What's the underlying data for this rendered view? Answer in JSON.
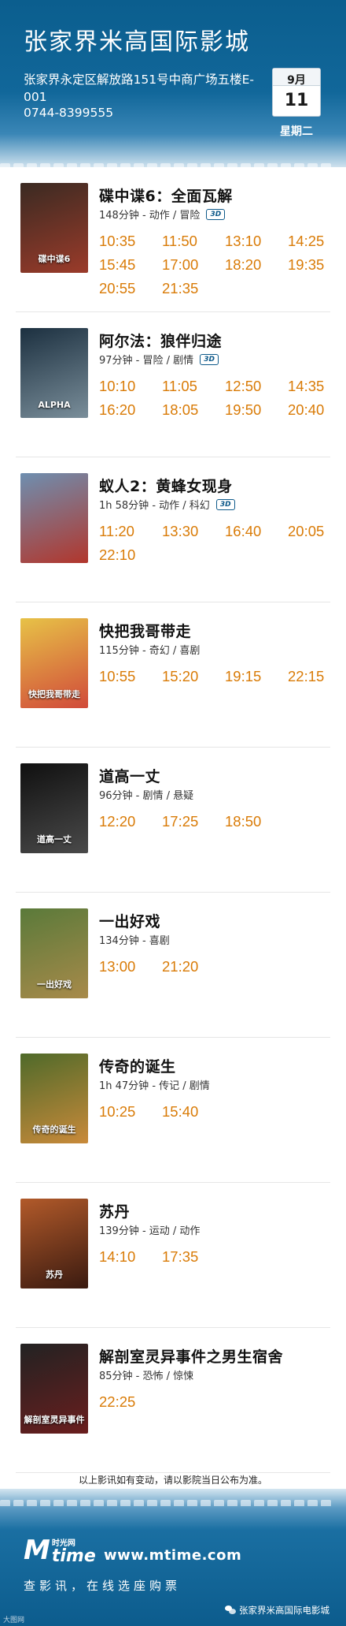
{
  "header": {
    "cinema_name": "张家界米高国际影城",
    "address": "张家界永定区解放路151号中商广场五楼E-001",
    "phone": "0744-8399555",
    "date": {
      "month": "9月",
      "day": "11",
      "weekday": "星期二"
    }
  },
  "badge_label": "3D",
  "movies": [
    {
      "title": "碟中谍6：全面瓦解",
      "meta": "148分钟 - 动作 / 冒险",
      "is_3d": true,
      "times": [
        "10:35",
        "11:50",
        "13:10",
        "14:25",
        "15:45",
        "17:00",
        "18:20",
        "19:35",
        "20:55",
        "21:35"
      ],
      "poster_colors": [
        "#3a2a22",
        "#9b3b2a"
      ],
      "poster_text": "碟中谍6"
    },
    {
      "title": "阿尔法：狼伴归途",
      "meta": "97分钟 - 冒险 / 剧情",
      "is_3d": true,
      "times": [
        "10:10",
        "11:05",
        "12:50",
        "14:35",
        "16:20",
        "18:05",
        "19:50",
        "20:40"
      ],
      "poster_colors": [
        "#1c3040",
        "#7a8e9a"
      ],
      "poster_text": "ALPHA"
    },
    {
      "title": "蚁人2：黄蜂女现身",
      "meta": "1h 58分钟 - 动作 / 科幻",
      "is_3d": true,
      "times": [
        "11:20",
        "13:30",
        "16:40",
        "20:05",
        "22:10"
      ],
      "poster_colors": [
        "#6e8fb0",
        "#b2362c"
      ],
      "poster_text": ""
    },
    {
      "title": "快把我哥带走",
      "meta": "115分钟 - 奇幻 / 喜剧",
      "is_3d": false,
      "times": [
        "10:55",
        "15:20",
        "19:15",
        "22:15"
      ],
      "poster_colors": [
        "#e7c247",
        "#d14a3a"
      ],
      "poster_text": "快把我哥带走"
    },
    {
      "title": "道高一丈",
      "meta": "96分钟 - 剧情 / 悬疑",
      "is_3d": false,
      "times": [
        "12:20",
        "17:25",
        "18:50"
      ],
      "poster_colors": [
        "#101010",
        "#4a4a4a"
      ],
      "poster_text": "道高一丈"
    },
    {
      "title": "一出好戏",
      "meta": "134分钟 - 喜剧",
      "is_3d": false,
      "times": [
        "13:00",
        "21:20"
      ],
      "poster_colors": [
        "#5a7a3a",
        "#a88a4a"
      ],
      "poster_text": "一出好戏"
    },
    {
      "title": "传奇的诞生",
      "meta": "1h 47分钟 - 传记 / 剧情",
      "is_3d": false,
      "times": [
        "10:25",
        "15:40"
      ],
      "poster_colors": [
        "#4f6a2a",
        "#c98a3a"
      ],
      "poster_text": "传奇的诞生"
    },
    {
      "title": "苏丹",
      "meta": "139分钟 - 运动 / 动作",
      "is_3d": false,
      "times": [
        "14:10",
        "17:35"
      ],
      "poster_colors": [
        "#b25a2a",
        "#3a1a10"
      ],
      "poster_text": "苏丹"
    },
    {
      "title": "解剖室灵异事件之男生宿舍",
      "meta": "85分钟 - 恐怖 / 惊悚",
      "is_3d": false,
      "times": [
        "22:25"
      ],
      "poster_colors": [
        "#222222",
        "#6a1e1e"
      ],
      "poster_text": "解剖室灵异事件"
    }
  ],
  "notice": "以上影讯如有变动，请以影院当日公布为准。",
  "footer": {
    "logo_m": "M",
    "logo_cn": "时光网",
    "logo_time": "time",
    "url": "www.mtime.com",
    "slogan": "查影讯，在线选座购票",
    "weixin_account": "张家界米高国际电影城",
    "watermark": "大图网"
  }
}
